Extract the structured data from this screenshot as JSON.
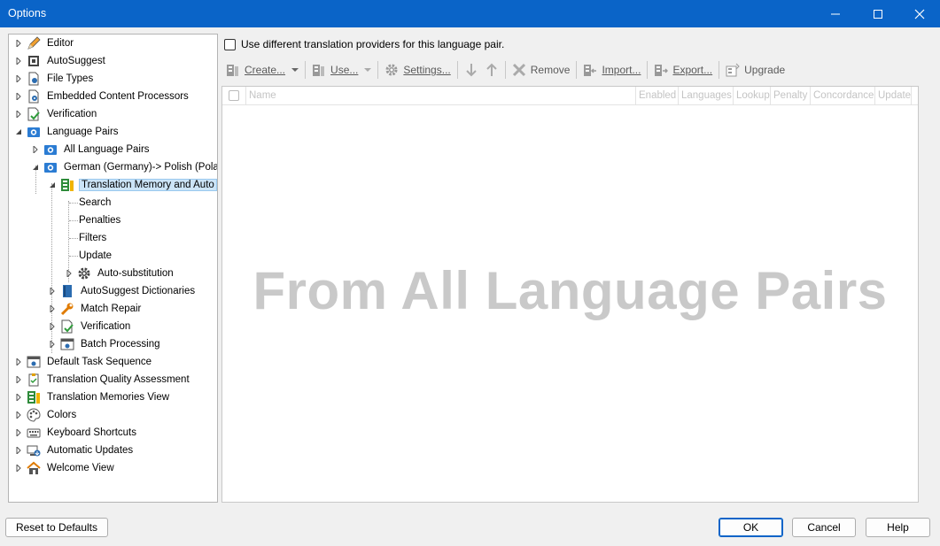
{
  "window": {
    "title": "Options"
  },
  "tree": {
    "items": [
      {
        "label": "Editor",
        "icon": "pencil-icon"
      },
      {
        "label": "AutoSuggest",
        "icon": "autosuggest-icon"
      },
      {
        "label": "File Types",
        "icon": "file-types-icon"
      },
      {
        "label": "Embedded Content Processors",
        "icon": "embedded-content-icon"
      },
      {
        "label": "Verification",
        "icon": "verification-icon"
      },
      {
        "label": "Language Pairs",
        "icon": "language-pairs-icon"
      },
      {
        "label": "All Language Pairs",
        "icon": "language-pairs-icon"
      },
      {
        "label": "German (Germany)-> Polish (Polan",
        "icon": "language-pairs-icon"
      },
      {
        "label": "Translation Memory and Auto",
        "icon": "translation-memory-icon"
      },
      {
        "label": "Search",
        "icon": ""
      },
      {
        "label": "Penalties",
        "icon": ""
      },
      {
        "label": "Filters",
        "icon": ""
      },
      {
        "label": "Update",
        "icon": ""
      },
      {
        "label": "Auto-substitution",
        "icon": "gear-icon"
      },
      {
        "label": "AutoSuggest Dictionaries",
        "icon": "dictionary-icon"
      },
      {
        "label": "Match Repair",
        "icon": "wrench-icon"
      },
      {
        "label": "Verification",
        "icon": "verification-icon"
      },
      {
        "label": "Batch Processing",
        "icon": "batch-processing-icon"
      },
      {
        "label": "Default Task Sequence",
        "icon": "task-sequence-icon"
      },
      {
        "label": "Translation Quality Assessment",
        "icon": "quality-assessment-icon"
      },
      {
        "label": "Translation Memories View",
        "icon": "translation-memory-icon"
      },
      {
        "label": "Colors",
        "icon": "palette-icon"
      },
      {
        "label": "Keyboard Shortcuts",
        "icon": "keyboard-icon"
      },
      {
        "label": "Automatic Updates",
        "icon": "update-icon"
      },
      {
        "label": "Welcome View",
        "icon": "home-icon"
      }
    ]
  },
  "main": {
    "use_different_label": "Use different translation providers for this language pair.",
    "toolbar": {
      "create": "Create...",
      "use": "Use...",
      "settings": "Settings...",
      "remove": "Remove",
      "import": "Import...",
      "export": "Export...",
      "upgrade": "Upgrade"
    },
    "grid": {
      "columns": [
        "Name",
        "Enabled",
        "Languages",
        "Lookup",
        "Penalty",
        "Concordance",
        "Update"
      ],
      "watermark": "From All Language Pairs"
    }
  },
  "footer": {
    "reset": "Reset to Defaults",
    "ok": "OK",
    "cancel": "Cancel",
    "help": "Help"
  },
  "colors": {
    "titlebar": "#0a64c8",
    "selection": "#cce4f7"
  }
}
